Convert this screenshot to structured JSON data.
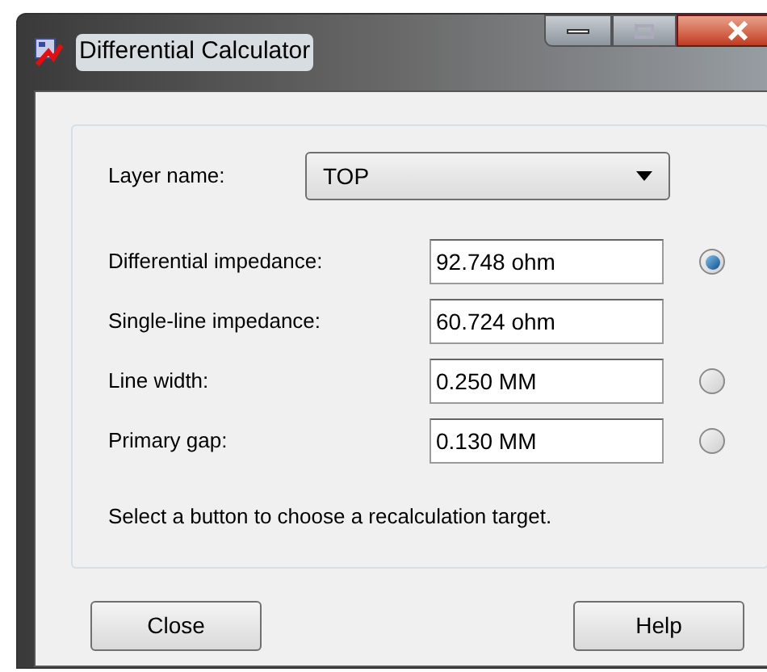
{
  "window": {
    "title": "Differential Calculator"
  },
  "layer": {
    "label": "Layer name:",
    "value": "TOP"
  },
  "rows": [
    {
      "label": "Differential impedance:",
      "value": "92.748 ohm",
      "radio": {
        "selected": true
      }
    },
    {
      "label": "Single-line impedance:",
      "value": "60.724 ohm"
    },
    {
      "label": "Line width:",
      "value": "0.250 MM",
      "radio": {
        "selected": false
      }
    },
    {
      "label": "Primary gap:",
      "value": "0.130 MM",
      "radio": {
        "selected": false
      }
    }
  ],
  "hint": "Select a button to choose a recalculation target.",
  "buttons": [
    "Close",
    "Help"
  ]
}
